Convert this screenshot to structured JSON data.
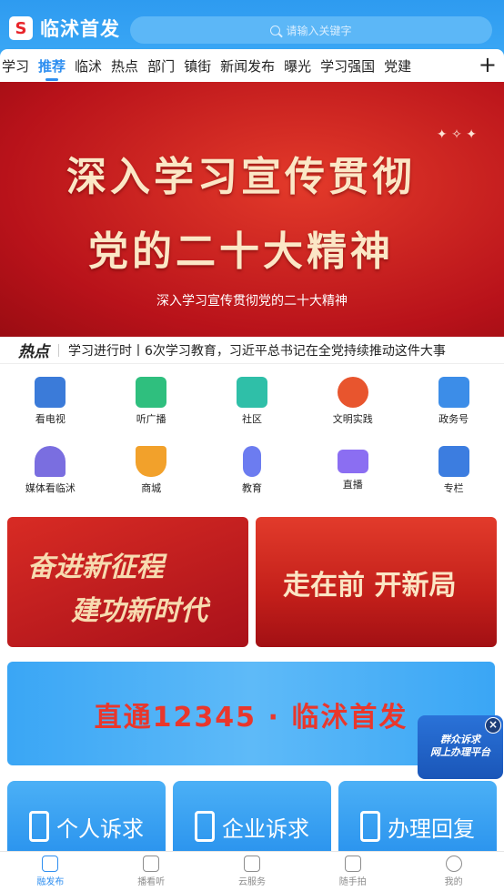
{
  "header": {
    "brand": "临沭首发",
    "logo_glyph": "S",
    "search_placeholder": "请输入关键字"
  },
  "nav": {
    "tabs": [
      "学习",
      "推荐",
      "临沭",
      "热点",
      "部门",
      "镇街",
      "新闻发布",
      "曝光",
      "学习强国",
      "党建"
    ],
    "active_index": 1
  },
  "banner": {
    "line1": "深入学习宣传贯彻",
    "line2": "党的二十大精神",
    "caption": "深入学习宣传贯彻党的二十大精神"
  },
  "hot": {
    "tag": "热点",
    "text": "学习进行时丨6次学习教育，习近平总书记在全党持续推动这件大事"
  },
  "grid": {
    "row1": [
      {
        "label": "看电视",
        "icon": "tv-icon",
        "color": "#3b7bd9"
      },
      {
        "label": "听广播",
        "icon": "radio-icon",
        "color": "#2fbf7e"
      },
      {
        "label": "社区",
        "icon": "building-icon",
        "color": "#2fbfa8"
      },
      {
        "label": "文明实践",
        "icon": "flower-icon",
        "color": "#e8552e"
      },
      {
        "label": "政务号",
        "icon": "document-icon",
        "color": "#3c8de8"
      }
    ],
    "row2": [
      {
        "label": "媒体看临沭",
        "icon": "alarm-icon",
        "color": "#7a6ee0"
      },
      {
        "label": "商城",
        "icon": "cup-icon",
        "color": "#f2a12b"
      },
      {
        "label": "教育",
        "icon": "education-icon",
        "color": "#6c7cf0"
      },
      {
        "label": "直播",
        "icon": "video-icon",
        "color": "#8b6ef2"
      },
      {
        "label": "专栏",
        "icon": "column-icon",
        "color": "#3c7de0"
      }
    ]
  },
  "cards": {
    "left_line1": "奋进新征程",
    "left_line2": "建功新时代",
    "right_text": "走在前 开新局"
  },
  "wide_banner": {
    "text": "直通12345 · 临沭首发"
  },
  "float_badge": {
    "line1": "群众诉求",
    "line2": "网上办理平台",
    "close": "×"
  },
  "services": [
    "个人诉求",
    "企业诉求",
    "办理回复"
  ],
  "tabbar": {
    "items": [
      "融发布",
      "播看听",
      "云服务",
      "随手拍",
      "我的"
    ],
    "active_index": 0
  }
}
